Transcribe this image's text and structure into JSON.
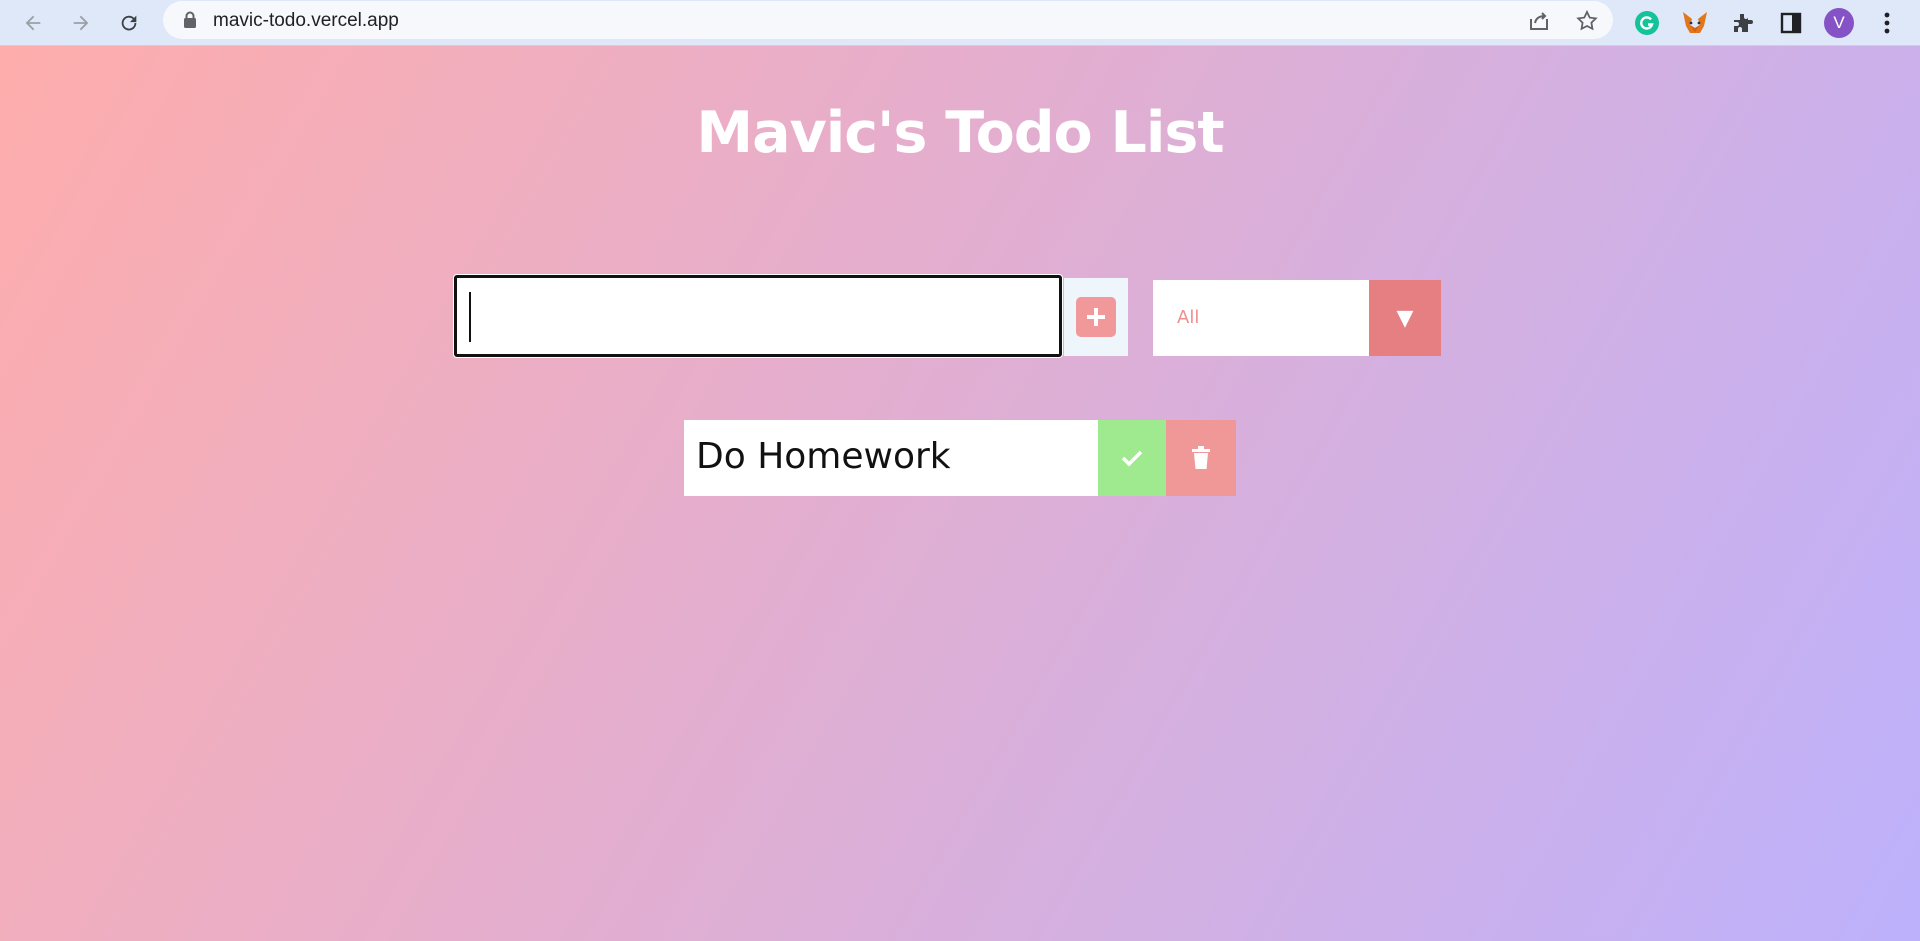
{
  "browser": {
    "url": "mavic-todo.vercel.app",
    "profile_initial": "V",
    "icons": [
      "back-icon",
      "forward-icon",
      "reload-icon",
      "lock-icon",
      "share-icon",
      "star-icon",
      "grammarly-icon",
      "metamask-icon",
      "extensions-icon",
      "side-panel-icon",
      "menu-icon"
    ]
  },
  "app": {
    "title": "Mavic's Todo List",
    "input": {
      "value": "",
      "placeholder": ""
    },
    "add_button_icon": "plus-icon",
    "filter": {
      "selected": "All"
    },
    "todos": [
      {
        "text": "Do Homework",
        "completed": false
      }
    ]
  },
  "colors": {
    "gradient_start": "#ffadab",
    "gradient_end": "#bdb1fc",
    "add_button": "#f0989a",
    "select_text": "#ef8f8e",
    "select_arrow_bg": "#e57f82",
    "complete_button": "#9fea8f",
    "trash_button": "#f09898"
  }
}
